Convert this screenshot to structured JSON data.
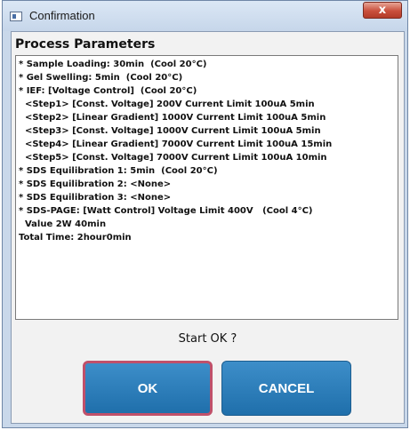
{
  "window": {
    "title": "Confirmation",
    "close_glyph": "x"
  },
  "dialog": {
    "section_title": "Process Parameters",
    "params": [
      "* Sample Loading: 30min  (Cool 20°C)",
      "* Gel Swelling: 5min  (Cool 20°C)",
      "* IEF: [Voltage Control]  (Cool 20°C)",
      "  <Step1> [Const. Voltage] 200V Current Limit 100uA 5min",
      "  <Step2> [Linear Gradient] 1000V Current Limit 100uA 5min",
      "  <Step3> [Const. Voltage] 1000V Current Limit 100uA 5min",
      "  <Step4> [Linear Gradient] 7000V Current Limit 100uA 15min",
      "  <Step5> [Const. Voltage] 7000V Current Limit 100uA 10min",
      "* SDS Equilibration 1: 5min  (Cool 20°C)",
      "* SDS Equilibration 2: <None>",
      "* SDS Equilibration 3: <None>",
      "* SDS-PAGE: [Watt Control] Voltage Limit 400V   (Cool 4°C)",
      "  Value 2W 40min",
      "Total Time: 2hour0min"
    ],
    "prompt": "Start OK ?",
    "ok_label": "OK",
    "cancel_label": "CANCEL"
  },
  "colors": {
    "button": "#2a7ab8",
    "ok_focus_border": "#c0506a",
    "close_button": "#c94f3c",
    "window_frame": "#c9d8ea"
  },
  "icons": {
    "title": "window-icon",
    "close": "close-icon"
  }
}
